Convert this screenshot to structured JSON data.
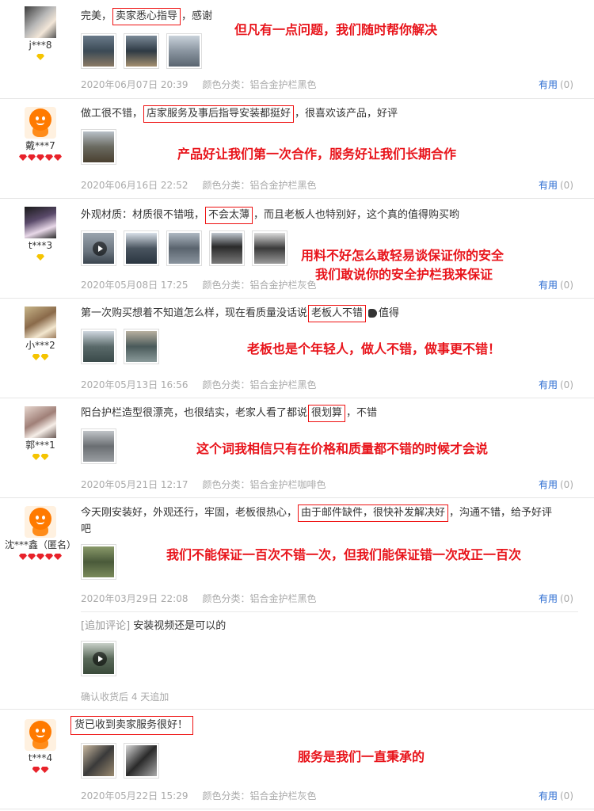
{
  "reviews": [
    {
      "username": "j***8",
      "text_before": "完美，",
      "highlight": "卖家悉心指导",
      "text_after": "，感谢",
      "date": "2020年06月07日 20:39",
      "spec": "颜色分类：铝合金护栏黑色",
      "helpful_label": "有用",
      "helpful_count": "(0)",
      "note": "但凡有一点问题，我们随时帮你解决"
    },
    {
      "username": "戴***7",
      "text_before": "做工很不错，",
      "highlight": "店家服务及事后指导安装都挺好",
      "text_after": "，很喜欢该产品，好评",
      "date": "2020年06月16日 22:52",
      "spec": "颜色分类：铝合金护栏黑色",
      "helpful_label": "有用",
      "helpful_count": "(0)",
      "note": "产品好让我们第一次合作，服务好让我们长期合作"
    },
    {
      "username": "t***3",
      "text_before": "外观材质：材质很不错哦，",
      "highlight": "不会太薄",
      "text_after": "，而且老板人也特别好，这个真的值得购买哟",
      "date": "2020年05月08日 17:25",
      "spec": "颜色分类：铝合金护栏灰色",
      "helpful_label": "有用",
      "helpful_count": "(0)",
      "note_line1": "用料不好怎么敢轻易谈保证你的安全",
      "note_line2": "我们敢说你的安全护栏我来保证"
    },
    {
      "username": "小***2",
      "text_before": "第一次购买想着不知道怎么样，现在看质量没话说",
      "highlight": "老板人不错",
      "text_after": "值得",
      "date": "2020年05月13日 16:56",
      "spec": "颜色分类：铝合金护栏黑色",
      "helpful_label": "有用",
      "helpful_count": "(0)",
      "note": "老板也是个年轻人，做人不错，做事更不错！"
    },
    {
      "username": "郭***1",
      "text_before": "阳台护栏造型很漂亮，也很结实，老家人看了都说",
      "highlight": "很划算",
      "text_after": "，不错",
      "date": "2020年05月21日 12:17",
      "spec": "颜色分类：铝合金护栏咖啡色",
      "helpful_label": "有用",
      "helpful_count": "(0)",
      "note": "这个词我相信只有在价格和质量都不错的时候才会说"
    },
    {
      "username": "沈***鑫（匿名）",
      "text_before": "今天刚安装好，外观还行，牢固，老板很热心，",
      "highlight": "由于邮件缺件，很快补发解决好",
      "text_after": "，沟通不错，给予好评",
      "text_line2": "吧",
      "date": "2020年03月29日 22:08",
      "spec": "颜色分类：铝合金护栏黑色",
      "helpful_label": "有用",
      "helpful_count": "(0)",
      "note": "我们不能保证一百次不错一次，但我们能保证错一次改正一百次",
      "append_label": "[追加评论]",
      "append_text": " 安装视频还是可以的",
      "append_time": "确认收货后 4 天追加"
    },
    {
      "username": "t***4",
      "highlight": "货已收到卖家服务很好！",
      "date": "2020年05月22日 15:29",
      "spec": "颜色分类：铝合金护栏灰色",
      "helpful_label": "有用",
      "helpful_count": "(0)",
      "note": "服务是我们一直秉承的"
    }
  ],
  "colors": {
    "note_red": "#e8141b",
    "helpful_blue": "#2a6bd1",
    "meta_gray": "#aaaaaa",
    "gem_yellow": "#f5c400",
    "gem_red": "#e8222a"
  }
}
